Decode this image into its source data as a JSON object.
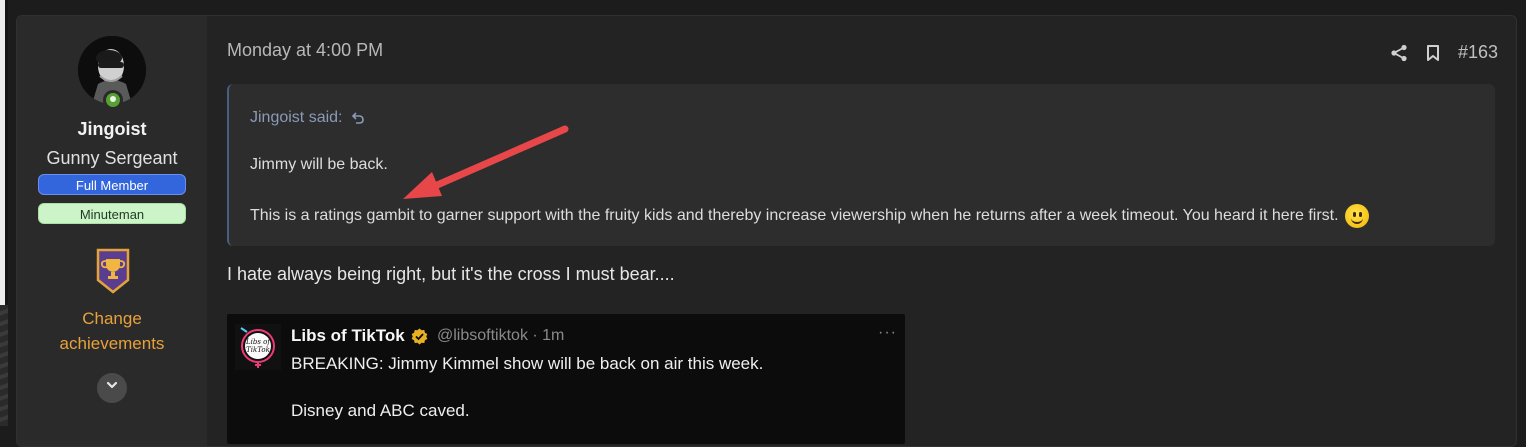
{
  "post": {
    "date": "Monday at 4:00 PM",
    "number": "#163"
  },
  "user": {
    "name": "Jingoist",
    "title": "Gunny Sergeant",
    "banners": [
      "Full Member",
      "Minuteman"
    ],
    "change_achievements": [
      "Change",
      "achievements"
    ]
  },
  "quote": {
    "attribution": "Jingoist said:",
    "paragraph1": "Jimmy will be back.",
    "paragraph2": "This is a ratings gambit to garner support with the fruity kids and thereby increase viewership when he returns after a week timeout. You heard it here first."
  },
  "reply": {
    "text": "I hate always being right, but it's the cross I must bear...."
  },
  "tweet": {
    "author": "Libs of TikTok",
    "handle": "@libsoftiktok · 1m",
    "avatar_text": [
      "Libs of",
      "TikTok"
    ],
    "line1": "BREAKING: Jimmy Kimmel show will be back on air this week.",
    "line2": "Disney and ABC caved.",
    "more": "···"
  },
  "icons": {
    "share": "share-icon",
    "bookmark": "bookmark-icon",
    "quote_link": "quote-return-icon",
    "expand": "chevron-down-icon",
    "verified": "verified-badge-icon",
    "emoji": "smile-emoji-icon",
    "annotation": "red-arrow"
  },
  "colors": {
    "accent_blue": "#3366dd",
    "accent_green": "#ccf4c8",
    "achievement_orange": "#e8a13a",
    "arrow_red": "#e8474a"
  }
}
